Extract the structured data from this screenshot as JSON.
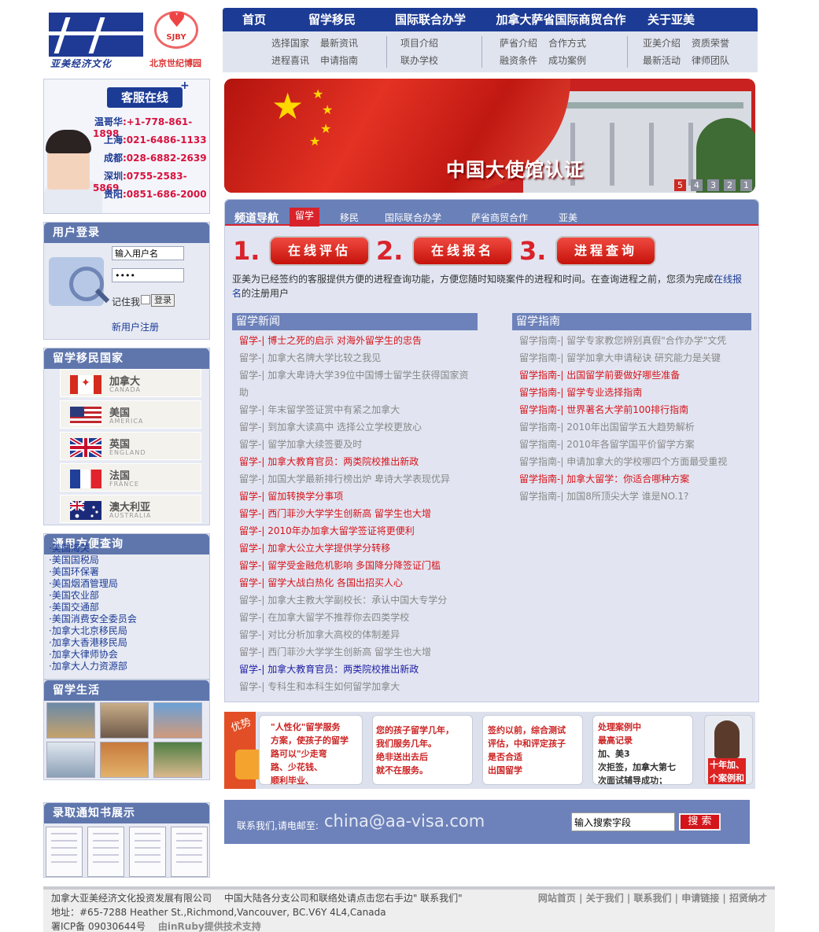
{
  "logo": {
    "cn_text": "亚美经济文化",
    "seal_text": "SJBY",
    "sub_text": "北京世纪博园"
  },
  "topnav": {
    "tabs": [
      "首页",
      "留学移民",
      "国际联合办学",
      "加拿大萨省国际商贸合作",
      "关于亚美"
    ],
    "groups": [
      [
        "选择国家",
        "最新资讯",
        "进程喜讯",
        "申请指南"
      ],
      [
        "项目介绍",
        "联办学校"
      ],
      [
        "萨省介绍",
        "合作方式",
        "融资条件",
        "成功案例"
      ],
      [
        "亚美介绍",
        "资质荣誉",
        "最新活动",
        "律师团队"
      ]
    ]
  },
  "service": {
    "title": "客服在线",
    "phones": [
      {
        "city": "温哥华",
        "num": ":+1-778-861-1898"
      },
      {
        "city": "上海",
        "num": ":021-6486-1133"
      },
      {
        "city": "成都",
        "num": ":028-6882-2639"
      },
      {
        "city": "深圳",
        "num": ":0755-2583-5869"
      },
      {
        "city": "贵阳",
        "num": ":0851-686-2000"
      }
    ]
  },
  "login": {
    "title": "用户登录",
    "username_value": "输入用户名",
    "password_value": "••••",
    "remember": "记住我",
    "login_btn": "登录",
    "register": "新用户注册"
  },
  "countries": {
    "title": "留学移民国家",
    "items": [
      {
        "cn": "加拿大",
        "en": "CANADA"
      },
      {
        "cn": "美国",
        "en": "AMERICA"
      },
      {
        "cn": "英国",
        "en": "ENGLAND"
      },
      {
        "cn": "法国",
        "en": "FRANCE"
      },
      {
        "cn": "澳大利亚",
        "en": "AUSTRALIA"
      }
    ]
  },
  "quick": {
    "title": "通用方便查询",
    "items": [
      "·美国海关",
      "·美国国税局",
      "·美国环保署",
      "·美国烟酒管理局",
      "·美国农业部",
      "·美国交通部",
      "·美国消费安全委员会",
      "·加拿大北京移民局",
      "·加拿大香港移民局",
      "·加拿大律师协会",
      "·加拿大人力资源部"
    ]
  },
  "life": {
    "title": "留学生活"
  },
  "offers": {
    "title": "录取通知书展示"
  },
  "banner": {
    "caption": "中国大使馆认证",
    "pages": [
      "5",
      "4",
      "3",
      "2",
      "1"
    ]
  },
  "channel": {
    "label": "频道导航",
    "tabs": [
      "留学",
      "移民",
      "国际联合办学",
      "萨省商贸合作",
      "亚美"
    ]
  },
  "steps": [
    {
      "num": "1.",
      "label": "在线评估"
    },
    {
      "num": "2.",
      "label": "在线报名"
    },
    {
      "num": "3.",
      "label": "进程查询"
    }
  ],
  "intro": {
    "before": "亚美为已经签约的客服提供方便的进程查询功能，方便您随时知晓案件的进程和时间。在查询进程之前，您须为完成",
    "link": "在线报名",
    "after": "的注册用户"
  },
  "news": {
    "title": "留学新闻",
    "items": [
      {
        "t": "留学-| 博士之死的启示 对海外留学生的忠告",
        "c": "red"
      },
      {
        "t": "留学-| 加拿大名牌大学比较之我见",
        "c": "gray"
      },
      {
        "t": "留学-| 加拿大卑诗大学39位中国博士留学生获得国家资",
        "c": "gray"
      },
      {
        "t": "助",
        "c": "gray"
      },
      {
        "t": "留学-| 年末留学签证赏中有紧之加拿大",
        "c": "gray"
      },
      {
        "t": "留学-| 到加拿大读高中 选择公立学校更放心",
        "c": "gray"
      },
      {
        "t": "留学-| 留学加拿大续签要及时",
        "c": "gray"
      },
      {
        "t": "留学-| 加拿大教育官员：两类院校推出新政",
        "c": "red"
      },
      {
        "t": "留学-| 加国大学最新排行榜出炉 卑诗大学表现优异",
        "c": "gray"
      },
      {
        "t": "留学-| 留加转换学分事项",
        "c": "red"
      },
      {
        "t": "留学-| 西门菲沙大学学生创新高 留学生也大增",
        "c": "red"
      },
      {
        "t": "留学-| 2010年办加拿大留学签证将更便利",
        "c": "red"
      },
      {
        "t": "留学-| 加拿大公立大学提供学分转移",
        "c": "red"
      },
      {
        "t": "留学-| 留学受金融危机影响 多国降分降签证门槛",
        "c": "red"
      },
      {
        "t": "留学-| 留学大战白热化 各国出招买人心",
        "c": "red"
      },
      {
        "t": "留学-| 加拿大主教大学副校长：承认中国大专学分",
        "c": "gray"
      },
      {
        "t": "留学-| 在加拿大留学不推荐你去四类学校",
        "c": "gray"
      },
      {
        "t": "留学-| 对比分析加拿大高校的体制差异",
        "c": "gray"
      },
      {
        "t": "留学-| 西门菲沙大学学生创新高 留学生也大增",
        "c": "gray"
      },
      {
        "t": "留学-| 加拿大教育官员：两类院校推出新政",
        "c": "blue"
      },
      {
        "t": "留学-| 专科生和本科生如何留学加拿大",
        "c": "gray"
      }
    ]
  },
  "guide": {
    "title": "留学指南",
    "items": [
      {
        "t": "留学指南-| 留学专家教您辨别真假\"合作办学\"文凭",
        "c": "gray"
      },
      {
        "t": "留学指南-| 留学加拿大申请秘诀 研究能力是关键",
        "c": "gray"
      },
      {
        "t": "留学指南-| 出国留学前要做好哪些准备",
        "c": "red"
      },
      {
        "t": "留学指南-| 留学专业选择指南",
        "c": "red"
      },
      {
        "t": "留学指南-| 世界著名大学前100排行指南",
        "c": "red"
      },
      {
        "t": "留学指南-| 2010年出国留学五大趋势解析",
        "c": "gray"
      },
      {
        "t": "留学指南-| 2010年各留学国平价留学方案",
        "c": "gray"
      },
      {
        "t": "留学指南-| 申请加拿大的学校哪四个方面最受重视",
        "c": "gray"
      },
      {
        "t": "留学指南-| 加拿大留学：你适合哪种方案",
        "c": "red"
      },
      {
        "t": "留学指南-| 加国8所顶尖大学 谁是NO.1?",
        "c": "gray"
      }
    ]
  },
  "ads": {
    "badge": "优势",
    "cards": [
      {
        "lines": [
          "\"人性化\"留学服务",
          "方案，使孩子的留学",
          "路可以\"少走弯",
          "路、少花钱、",
          "顺利毕业、",
          "早日移民\""
        ]
      },
      {
        "lines": [
          "您的孩子留学几年，",
          "我们服务几年。",
          "绝非送出去后",
          "就不在服务。"
        ]
      },
      {
        "lines": [
          "签约以前，综合测试",
          "评估，中和评定孩子",
          "是否合适",
          "出国留学"
        ]
      },
      {
        "lines": [
          "处理案例中",
          "最高记录",
          "加、美3",
          "次拒签，加拿大第七",
          "次面试辅导成功；"
        ]
      },
      {
        "lines": [
          "十年加、",
          "个案例和"
        ]
      }
    ]
  },
  "contact": {
    "label": "联系我们,请电邮至:",
    "email": "china@aa-visa.com",
    "search_placeholder": "输入搜索字段",
    "search_btn": "搜 索"
  },
  "footer": {
    "line1": "加拿大亚美经济文化投资发展有限公司　 中国大陆各分支公司和联络处请点击您右手边\" 联系我们\"",
    "line2": "地址：#65-7288 Heather St.,Richmond,Vancouver, BC.V6Y 4L4,Canada",
    "icp": "署ICP备 09030644号",
    "tech": "由inRuby提供技术支持",
    "links": [
      "网站首页",
      "关于我们",
      "联系我们",
      "申请链接",
      "招贤纳才"
    ]
  }
}
